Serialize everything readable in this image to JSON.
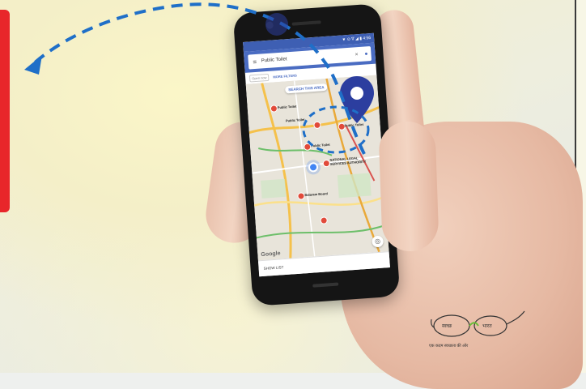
{
  "phone": {
    "status_bar": "▼ ⊙ ∇ ◢ ▮ 4:56",
    "search": {
      "query": "Public Toilet",
      "close_glyph": "×",
      "menu_glyph": "≡",
      "mic_glyph": "●"
    },
    "filters": {
      "open_now": "Open now",
      "more_filters": "MORE FILTERS"
    },
    "map": {
      "search_this_area": "SEARCH THIS AREA",
      "places": [
        {
          "label": "Public Toilet"
        },
        {
          "label": "Public Toilet"
        },
        {
          "label": "Public Toilet"
        },
        {
          "label": "Public Toilet"
        },
        {
          "label": "NATIONAL LEGAL SERVICES AUTHORITY"
        },
        {
          "label": "Balaram Board"
        }
      ],
      "google_logo": "Google"
    },
    "bottom": {
      "show_list": "SHOW LIST"
    }
  },
  "logo": {
    "word_left": "स्वच्छ",
    "word_right": "भारत",
    "tagline": "एक कदम स्वच्छता की ओर"
  },
  "colors": {
    "accent_blue": "#2c3e9f",
    "arrow_blue": "#1f6fc8",
    "panel_red": "#e8262a",
    "marker_red": "#e14a3a"
  },
  "icons": {
    "pin": "location-pin-icon",
    "arrow": "dashed-arrow-icon",
    "locate": "my-location-icon",
    "logo": "spectacles-logo-icon"
  }
}
